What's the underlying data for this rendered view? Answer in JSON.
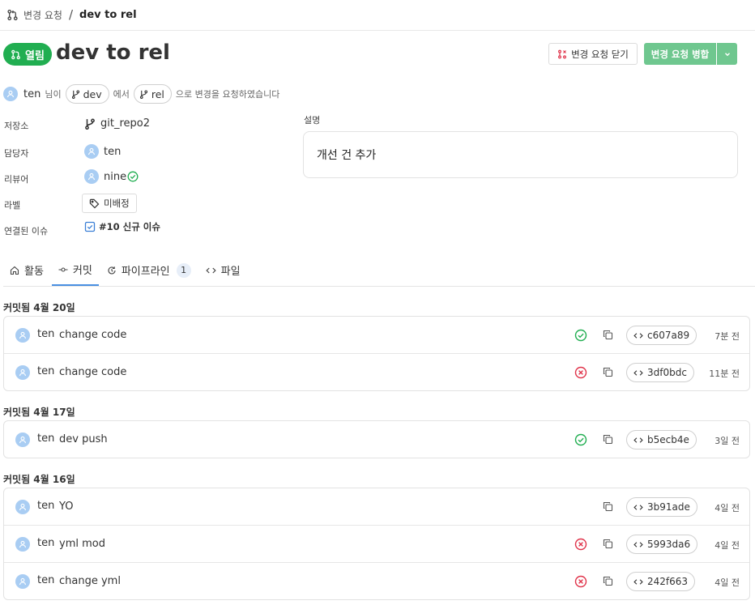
{
  "breadcrumb": {
    "parent": "변경 요청",
    "separator": "/",
    "current": "dev to rel"
  },
  "header": {
    "status": "열림",
    "title": "dev to rel",
    "close_button": "변경 요청 닫기",
    "merge_button": "변경 요청 병합"
  },
  "request": {
    "user": "ten",
    "prefix": "님이",
    "source_branch": "dev",
    "middle": "에서",
    "target_branch": "rel",
    "suffix": "으로 변경을 요청하였습니다"
  },
  "meta": {
    "repository": {
      "label": "저장소",
      "value": "git_repo2"
    },
    "assignee": {
      "label": "담당자",
      "value": "ten"
    },
    "reviewer": {
      "label": "리뷰어",
      "value": "nine"
    },
    "labels": {
      "label": "라벨",
      "value": "미배정"
    },
    "linked_issue": {
      "label": "연결된 이슈",
      "value": "#10 신규 이슈"
    }
  },
  "description": {
    "label": "설명",
    "text": "개선 건 추가"
  },
  "tabs": [
    {
      "label": "활동",
      "icon": "home-icon"
    },
    {
      "label": "커밋",
      "icon": "commit-icon"
    },
    {
      "label": "파이프라인",
      "icon": "pipeline-icon",
      "count": "1"
    },
    {
      "label": "파일",
      "icon": "code-icon"
    }
  ],
  "commit_groups": [
    {
      "title": "커밋됨 4월 20일",
      "commits": [
        {
          "author": "ten",
          "message": "change code",
          "status": "success",
          "sha": "c607a89",
          "ago": "7분 전"
        },
        {
          "author": "ten",
          "message": "change code",
          "status": "failed",
          "sha": "3df0bdc",
          "ago": "11분 전"
        }
      ]
    },
    {
      "title": "커밋됨 4월 17일",
      "commits": [
        {
          "author": "ten",
          "message": "dev push",
          "status": "success",
          "sha": "b5ecb4e",
          "ago": "3일 전"
        }
      ]
    },
    {
      "title": "커밋됨 4월 16일",
      "commits": [
        {
          "author": "ten",
          "message": "YO",
          "status": "none",
          "sha": "3b91ade",
          "ago": "4일 전"
        },
        {
          "author": "ten",
          "message": "yml mod",
          "status": "failed",
          "sha": "5993da6",
          "ago": "4일 전"
        },
        {
          "author": "ten",
          "message": "change yml",
          "status": "failed",
          "sha": "242f663",
          "ago": "4일 전"
        }
      ]
    }
  ],
  "colors": {
    "open": "#21ae51",
    "merge": "#6fc78f",
    "success": "#21ae51",
    "failed": "#e0334a",
    "tab_active": "#4a90e2"
  }
}
